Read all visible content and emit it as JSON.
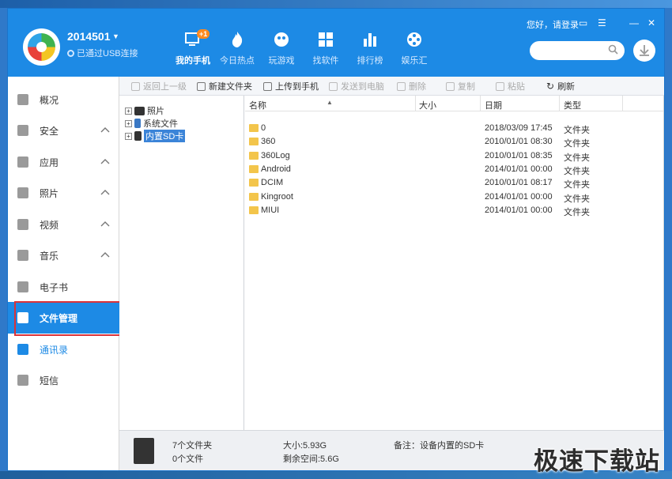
{
  "header": {
    "device_name": "2014501",
    "connection": "已通过USB连接",
    "login_text": "您好，请登录",
    "badge": "+1",
    "tabs": [
      {
        "label": "我的手机",
        "icon": "phone-icon",
        "active": true
      },
      {
        "label": "今日热点",
        "icon": "flame-icon"
      },
      {
        "label": "玩游戏",
        "icon": "gamepad-icon"
      },
      {
        "label": "找软件",
        "icon": "apps-icon"
      },
      {
        "label": "排行榜",
        "icon": "bar-chart-icon"
      },
      {
        "label": "娱乐汇",
        "icon": "film-reel-icon"
      }
    ],
    "search_placeholder": ""
  },
  "sidebar": {
    "items": [
      {
        "label": "概况",
        "icon": "home-icon"
      },
      {
        "label": "安全",
        "icon": "shield-icon"
      },
      {
        "label": "应用",
        "icon": "grid-icon"
      },
      {
        "label": "照片",
        "icon": "image-icon"
      },
      {
        "label": "视频",
        "icon": "play-icon"
      },
      {
        "label": "音乐",
        "icon": "music-icon"
      },
      {
        "label": "电子书",
        "icon": "book-icon"
      },
      {
        "label": "文件管理",
        "icon": "folder-icon"
      },
      {
        "label": "通讯录",
        "icon": "phone-call-icon"
      },
      {
        "label": "短信",
        "icon": "message-icon"
      }
    ]
  },
  "toolbar": {
    "back": "返回上一级",
    "new_folder": "新建文件夹",
    "upload": "上传到手机",
    "send_pc": "发送到电脑",
    "delete": "删除",
    "copy": "复制",
    "paste": "粘贴",
    "refresh": "刷新"
  },
  "tree": [
    {
      "label": "照片",
      "icon": "camera-icon"
    },
    {
      "label": "系统文件",
      "icon": "phone-small-icon"
    },
    {
      "label": "内置SD卡",
      "icon": "sd-card-icon"
    }
  ],
  "file_list": {
    "columns": [
      "名称",
      "大小",
      "日期",
      "类型"
    ],
    "rows": [
      {
        "name": "0",
        "size": "",
        "date": "2018/03/09 17:45",
        "type": "文件夹"
      },
      {
        "name": "360",
        "size": "",
        "date": "2010/01/01 08:30",
        "type": "文件夹"
      },
      {
        "name": "360Log",
        "size": "",
        "date": "2010/01/01 08:35",
        "type": "文件夹"
      },
      {
        "name": "Android",
        "size": "",
        "date": "2014/01/01 00:00",
        "type": "文件夹"
      },
      {
        "name": "DCIM",
        "size": "",
        "date": "2010/01/01 08:17",
        "type": "文件夹"
      },
      {
        "name": "Kingroot",
        "size": "",
        "date": "2014/01/01 00:00",
        "type": "文件夹"
      },
      {
        "name": "MIUI",
        "size": "",
        "date": "2014/01/01 00:00",
        "type": "文件夹"
      }
    ]
  },
  "status": {
    "folders": "7个文件夹",
    "files": "0个文件",
    "size": "大小:5.93G",
    "free": "剩余空间:5.6G",
    "note": "备注：设备内置的SD卡"
  },
  "watermark": "极速下载站",
  "colors": {
    "brand": "#1d8ae5",
    "highlight_box": "#d9333a"
  }
}
